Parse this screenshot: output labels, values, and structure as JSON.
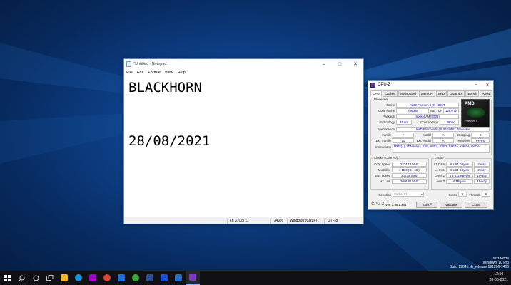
{
  "notepad": {
    "title": "*Untitled - Notepad",
    "menu": [
      "File",
      "Edit",
      "Format",
      "View",
      "Help"
    ],
    "content": "BLACKHORN\n\n\n28/08/2021",
    "status": {
      "position": "Ln 3, Col 11",
      "zoom": "340%",
      "line_ending": "Windows (CRLF)",
      "encoding": "UTF-8"
    }
  },
  "cpuz": {
    "title": "CPU-Z",
    "tabs": [
      "CPU",
      "Caches",
      "Mainboard",
      "Memory",
      "SPD",
      "Graphics",
      "Bench",
      "About"
    ],
    "active_tab": "CPU",
    "processor": {
      "group": "Processor",
      "name_label": "Name",
      "name": "AMD Phenom II X6 1090T",
      "codename_label": "Code Name",
      "codename": "Thuban",
      "maxtdp_label": "Max TDP",
      "maxtdp": "126.0 W",
      "package_label": "Package",
      "package": "Socket AM3 (938)",
      "technology_label": "Technology",
      "technology": "45 nm",
      "corevoltage_label": "Core Voltage",
      "corevoltage": "1.380 V",
      "spec_label": "Specification",
      "spec": "AMD Phenom(tm) II X6 1090T Processor",
      "family_label": "Family",
      "family": "F",
      "model_label": "Model",
      "model": "A",
      "stepping_label": "Stepping",
      "stepping": "0",
      "extfamily_label": "Ext. Family",
      "extfamily": "10",
      "extmodel_label": "Ext. Model",
      "extmodel": "A",
      "revision_label": "Revision",
      "revision": "PH-E0",
      "instructions_label": "Instructions",
      "instructions": "MMX(+), 3DNow!(+), SSE, SSE2, SSE3, SSE4A, x86-64, AMD-V"
    },
    "logo": {
      "brand": "AMD",
      "sub": "Phenom II"
    },
    "clocks": {
      "group": "Clocks (Core #0)",
      "corespeed_label": "Core Speed",
      "corespeed": "3214.19 MHz",
      "multiplier_label": "Multiplier",
      "multiplier": "x 16.0 ( 4 - 18 )",
      "busspeed_label": "Bus Speed",
      "busspeed": "200.88 MHz",
      "htlink_label": "HT Link",
      "htlink": "2008.84 MHz"
    },
    "cache": {
      "group": "Cache",
      "l1data_label": "L1 Data",
      "l1data": "6 x 64 KBytes",
      "l1data_way": "2-way",
      "l1inst_label": "L1 Inst.",
      "l1inst": "6 x 64 KBytes",
      "l1inst_way": "2-way",
      "level2_label": "Level 2",
      "level2": "6 x 512 KBytes",
      "level2_way": "16-way",
      "level3_label": "Level 3",
      "level3": "6 MBytes",
      "level3_way": "48-way"
    },
    "selection_label": "Selection",
    "selection": "Socket #1",
    "cores_label": "Cores",
    "cores": "6",
    "threads_label": "Threads",
    "threads": "6",
    "footer": {
      "brand": "CPU-Z",
      "version": "Ver. 1.96.1.x64",
      "tools": "Tools",
      "validate": "Validate",
      "close": "Close"
    }
  },
  "watermark": {
    "line1": "Test Mode",
    "line2": "Windows 10 Pro",
    "line3": "Build 19041.vb_release.191206-1406"
  },
  "taskbar": {
    "time": "13:50",
    "date": "28-08-2021",
    "colors": {
      "edge": "#1f8fd8",
      "explorer": "#f0b429",
      "chrome": "#db4437",
      "store": "#1e6fd9",
      "media": "#a000c8",
      "app1": "#3fa63a",
      "app2": "#2d4e8c",
      "bfont": "#1a4fd0",
      "bfont2": "#2b6cc4",
      "cpuz": "#7a3fb8"
    }
  }
}
